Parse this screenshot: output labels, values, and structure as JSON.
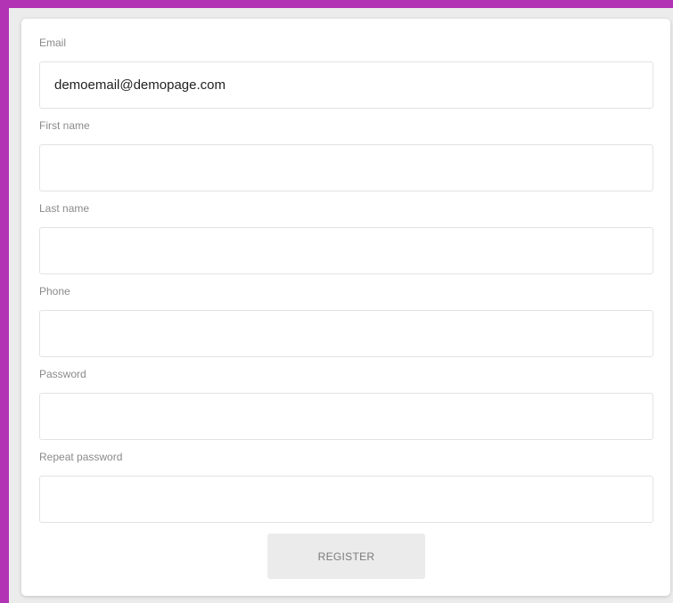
{
  "form": {
    "fields": [
      {
        "label": "Email",
        "value": "demoemail@demopage.com",
        "placeholder": ""
      },
      {
        "label": "First name",
        "value": "",
        "placeholder": ""
      },
      {
        "label": "Last name",
        "value": "",
        "placeholder": ""
      },
      {
        "label": "Phone",
        "value": "",
        "placeholder": ""
      },
      {
        "label": "Password",
        "value": "",
        "placeholder": ""
      },
      {
        "label": "Repeat password",
        "value": "",
        "placeholder": ""
      }
    ],
    "submit_label": "REGISTER"
  },
  "colors": {
    "frame": "#b233b4",
    "page_background": "#ececec",
    "card_background": "#ffffff",
    "button_background": "#ebebeb",
    "label_text": "#8a8a8a"
  }
}
